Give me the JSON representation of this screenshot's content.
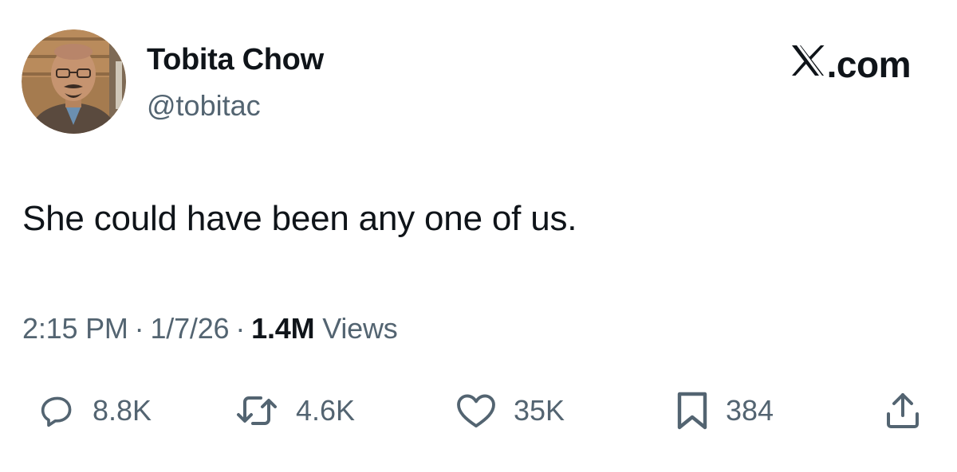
{
  "author": {
    "display_name": "Tobita Chow",
    "handle": "@tobitac",
    "avatar": "avatar-photo"
  },
  "brand": {
    "label": ".com",
    "logo_icon": "x-logo-icon"
  },
  "tweet": {
    "text": "She could have been any one of us."
  },
  "meta": {
    "time": "2:15 PM",
    "separator": "·",
    "date": "1/7/26",
    "views_count": "1.4M",
    "views_label": "Views"
  },
  "actions": {
    "reply": {
      "icon": "reply-icon",
      "count": "8.8K"
    },
    "retweet": {
      "icon": "retweet-icon",
      "count": "4.6K"
    },
    "like": {
      "icon": "heart-icon",
      "count": "35K"
    },
    "bookmark": {
      "icon": "bookmark-icon",
      "count": "384"
    },
    "share": {
      "icon": "share-icon"
    }
  },
  "colors": {
    "text_primary": "#0f1419",
    "text_secondary": "#536471",
    "background": "#ffffff"
  }
}
